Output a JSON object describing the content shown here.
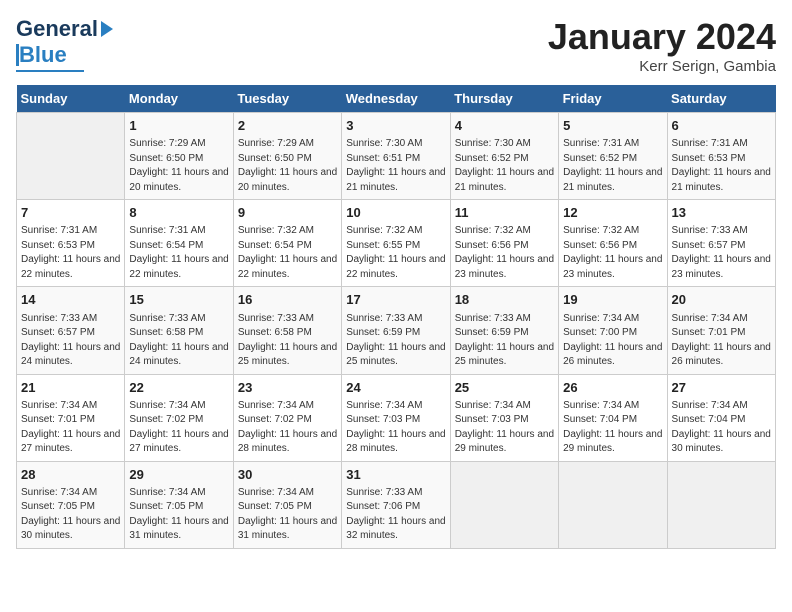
{
  "header": {
    "logo_general": "General",
    "logo_blue": "Blue",
    "month_title": "January 2024",
    "location": "Kerr Serign, Gambia"
  },
  "days_of_week": [
    "Sunday",
    "Monday",
    "Tuesday",
    "Wednesday",
    "Thursday",
    "Friday",
    "Saturday"
  ],
  "weeks": [
    [
      {
        "day": "",
        "empty": true
      },
      {
        "day": "1",
        "sunrise": "Sunrise: 7:29 AM",
        "sunset": "Sunset: 6:50 PM",
        "daylight": "Daylight: 11 hours and 20 minutes."
      },
      {
        "day": "2",
        "sunrise": "Sunrise: 7:29 AM",
        "sunset": "Sunset: 6:50 PM",
        "daylight": "Daylight: 11 hours and 20 minutes."
      },
      {
        "day": "3",
        "sunrise": "Sunrise: 7:30 AM",
        "sunset": "Sunset: 6:51 PM",
        "daylight": "Daylight: 11 hours and 21 minutes."
      },
      {
        "day": "4",
        "sunrise": "Sunrise: 7:30 AM",
        "sunset": "Sunset: 6:52 PM",
        "daylight": "Daylight: 11 hours and 21 minutes."
      },
      {
        "day": "5",
        "sunrise": "Sunrise: 7:31 AM",
        "sunset": "Sunset: 6:52 PM",
        "daylight": "Daylight: 11 hours and 21 minutes."
      },
      {
        "day": "6",
        "sunrise": "Sunrise: 7:31 AM",
        "sunset": "Sunset: 6:53 PM",
        "daylight": "Daylight: 11 hours and 21 minutes."
      }
    ],
    [
      {
        "day": "7",
        "sunrise": "Sunrise: 7:31 AM",
        "sunset": "Sunset: 6:53 PM",
        "daylight": "Daylight: 11 hours and 22 minutes."
      },
      {
        "day": "8",
        "sunrise": "Sunrise: 7:31 AM",
        "sunset": "Sunset: 6:54 PM",
        "daylight": "Daylight: 11 hours and 22 minutes."
      },
      {
        "day": "9",
        "sunrise": "Sunrise: 7:32 AM",
        "sunset": "Sunset: 6:54 PM",
        "daylight": "Daylight: 11 hours and 22 minutes."
      },
      {
        "day": "10",
        "sunrise": "Sunrise: 7:32 AM",
        "sunset": "Sunset: 6:55 PM",
        "daylight": "Daylight: 11 hours and 22 minutes."
      },
      {
        "day": "11",
        "sunrise": "Sunrise: 7:32 AM",
        "sunset": "Sunset: 6:56 PM",
        "daylight": "Daylight: 11 hours and 23 minutes."
      },
      {
        "day": "12",
        "sunrise": "Sunrise: 7:32 AM",
        "sunset": "Sunset: 6:56 PM",
        "daylight": "Daylight: 11 hours and 23 minutes."
      },
      {
        "day": "13",
        "sunrise": "Sunrise: 7:33 AM",
        "sunset": "Sunset: 6:57 PM",
        "daylight": "Daylight: 11 hours and 23 minutes."
      }
    ],
    [
      {
        "day": "14",
        "sunrise": "Sunrise: 7:33 AM",
        "sunset": "Sunset: 6:57 PM",
        "daylight": "Daylight: 11 hours and 24 minutes."
      },
      {
        "day": "15",
        "sunrise": "Sunrise: 7:33 AM",
        "sunset": "Sunset: 6:58 PM",
        "daylight": "Daylight: 11 hours and 24 minutes."
      },
      {
        "day": "16",
        "sunrise": "Sunrise: 7:33 AM",
        "sunset": "Sunset: 6:58 PM",
        "daylight": "Daylight: 11 hours and 25 minutes."
      },
      {
        "day": "17",
        "sunrise": "Sunrise: 7:33 AM",
        "sunset": "Sunset: 6:59 PM",
        "daylight": "Daylight: 11 hours and 25 minutes."
      },
      {
        "day": "18",
        "sunrise": "Sunrise: 7:33 AM",
        "sunset": "Sunset: 6:59 PM",
        "daylight": "Daylight: 11 hours and 25 minutes."
      },
      {
        "day": "19",
        "sunrise": "Sunrise: 7:34 AM",
        "sunset": "Sunset: 7:00 PM",
        "daylight": "Daylight: 11 hours and 26 minutes."
      },
      {
        "day": "20",
        "sunrise": "Sunrise: 7:34 AM",
        "sunset": "Sunset: 7:01 PM",
        "daylight": "Daylight: 11 hours and 26 minutes."
      }
    ],
    [
      {
        "day": "21",
        "sunrise": "Sunrise: 7:34 AM",
        "sunset": "Sunset: 7:01 PM",
        "daylight": "Daylight: 11 hours and 27 minutes."
      },
      {
        "day": "22",
        "sunrise": "Sunrise: 7:34 AM",
        "sunset": "Sunset: 7:02 PM",
        "daylight": "Daylight: 11 hours and 27 minutes."
      },
      {
        "day": "23",
        "sunrise": "Sunrise: 7:34 AM",
        "sunset": "Sunset: 7:02 PM",
        "daylight": "Daylight: 11 hours and 28 minutes."
      },
      {
        "day": "24",
        "sunrise": "Sunrise: 7:34 AM",
        "sunset": "Sunset: 7:03 PM",
        "daylight": "Daylight: 11 hours and 28 minutes."
      },
      {
        "day": "25",
        "sunrise": "Sunrise: 7:34 AM",
        "sunset": "Sunset: 7:03 PM",
        "daylight": "Daylight: 11 hours and 29 minutes."
      },
      {
        "day": "26",
        "sunrise": "Sunrise: 7:34 AM",
        "sunset": "Sunset: 7:04 PM",
        "daylight": "Daylight: 11 hours and 29 minutes."
      },
      {
        "day": "27",
        "sunrise": "Sunrise: 7:34 AM",
        "sunset": "Sunset: 7:04 PM",
        "daylight": "Daylight: 11 hours and 30 minutes."
      }
    ],
    [
      {
        "day": "28",
        "sunrise": "Sunrise: 7:34 AM",
        "sunset": "Sunset: 7:05 PM",
        "daylight": "Daylight: 11 hours and 30 minutes."
      },
      {
        "day": "29",
        "sunrise": "Sunrise: 7:34 AM",
        "sunset": "Sunset: 7:05 PM",
        "daylight": "Daylight: 11 hours and 31 minutes."
      },
      {
        "day": "30",
        "sunrise": "Sunrise: 7:34 AM",
        "sunset": "Sunset: 7:05 PM",
        "daylight": "Daylight: 11 hours and 31 minutes."
      },
      {
        "day": "31",
        "sunrise": "Sunrise: 7:33 AM",
        "sunset": "Sunset: 7:06 PM",
        "daylight": "Daylight: 11 hours and 32 minutes."
      },
      {
        "day": "",
        "empty": true
      },
      {
        "day": "",
        "empty": true
      },
      {
        "day": "",
        "empty": true
      }
    ]
  ]
}
